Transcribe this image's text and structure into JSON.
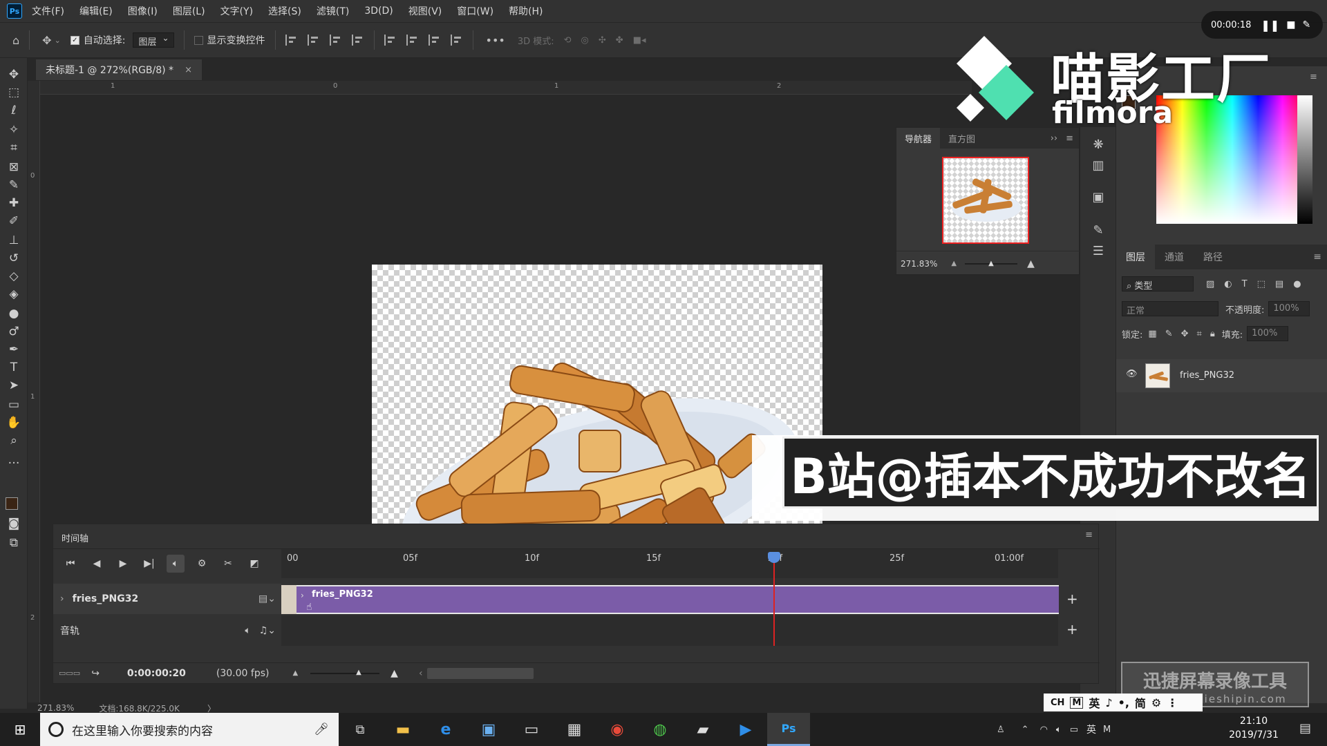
{
  "menubar": {
    "logo": "Ps",
    "items": [
      "文件(F)",
      "编辑(E)",
      "图像(I)",
      "图层(L)",
      "文字(Y)",
      "选择(S)",
      "滤镜(T)",
      "3D(D)",
      "视图(V)",
      "窗口(W)",
      "帮助(H)"
    ]
  },
  "options": {
    "auto_select_label": "自动选择:",
    "auto_select_target": "图层",
    "show_transform_label": "显示变换控件",
    "mode_3d_label": "3D 模式:"
  },
  "document": {
    "tab_title": "未标题-1 @ 272%(RGB/8) *",
    "close_glyph": "×"
  },
  "rulers": {
    "h_labels": [
      "1",
      "0",
      "1",
      "2"
    ],
    "v_labels": [
      "0",
      "1",
      "2"
    ]
  },
  "navigator": {
    "tabs": [
      "导航器",
      "直方图"
    ],
    "zoom": "271.83%",
    "zoom_level": 0.5
  },
  "colors": {
    "foreground": "#3a2414",
    "background": "#ffffff",
    "accent_purple": "#7b5ca8",
    "playhead": "#dd2222",
    "filmora_teal": "#4fe0b0"
  },
  "layers": {
    "tabs": [
      "图层",
      "通道",
      "路径"
    ],
    "filter_label": "类型",
    "blend_mode": "正常",
    "opacity_label": "不透明度:",
    "opacity_value": "100%",
    "lock_label": "锁定:",
    "fill_label": "填充:",
    "fill_value": "100%",
    "items": [
      {
        "name": "fries_PNG32",
        "visible": true
      }
    ]
  },
  "timeline": {
    "title": "时间轴",
    "ticks": [
      "00",
      "05f",
      "10f",
      "15f",
      "20f",
      "25f",
      "01:00f"
    ],
    "video_track": "fries_PNG32",
    "clip_label": "fries_PNG32",
    "audio_track": "音轨",
    "current_time": "0:00:00:20",
    "fps": "(30.00 fps)",
    "playhead_frame": 20
  },
  "statusbar": {
    "zoom": "271.83%",
    "doc_info": "文档:168.8K/225.0K",
    "arrow": "〉"
  },
  "taskbar": {
    "search_placeholder": "在这里输入你要搜索的内容",
    "time": "21:10",
    "date": "2019/7/31",
    "ime": [
      "CH",
      "M",
      "英",
      "♪",
      "•,",
      "简",
      "⚙",
      "⋮"
    ],
    "lang": "英"
  },
  "overlay": {
    "brand_cn": "喵影工厂",
    "brand_en": "filmora",
    "recording_time": "00:00:18",
    "caption": "B站@插本不成功不改名",
    "watermark_title": "迅捷屏幕录像工具",
    "watermark_url": "www.xunjieshipin.com"
  }
}
